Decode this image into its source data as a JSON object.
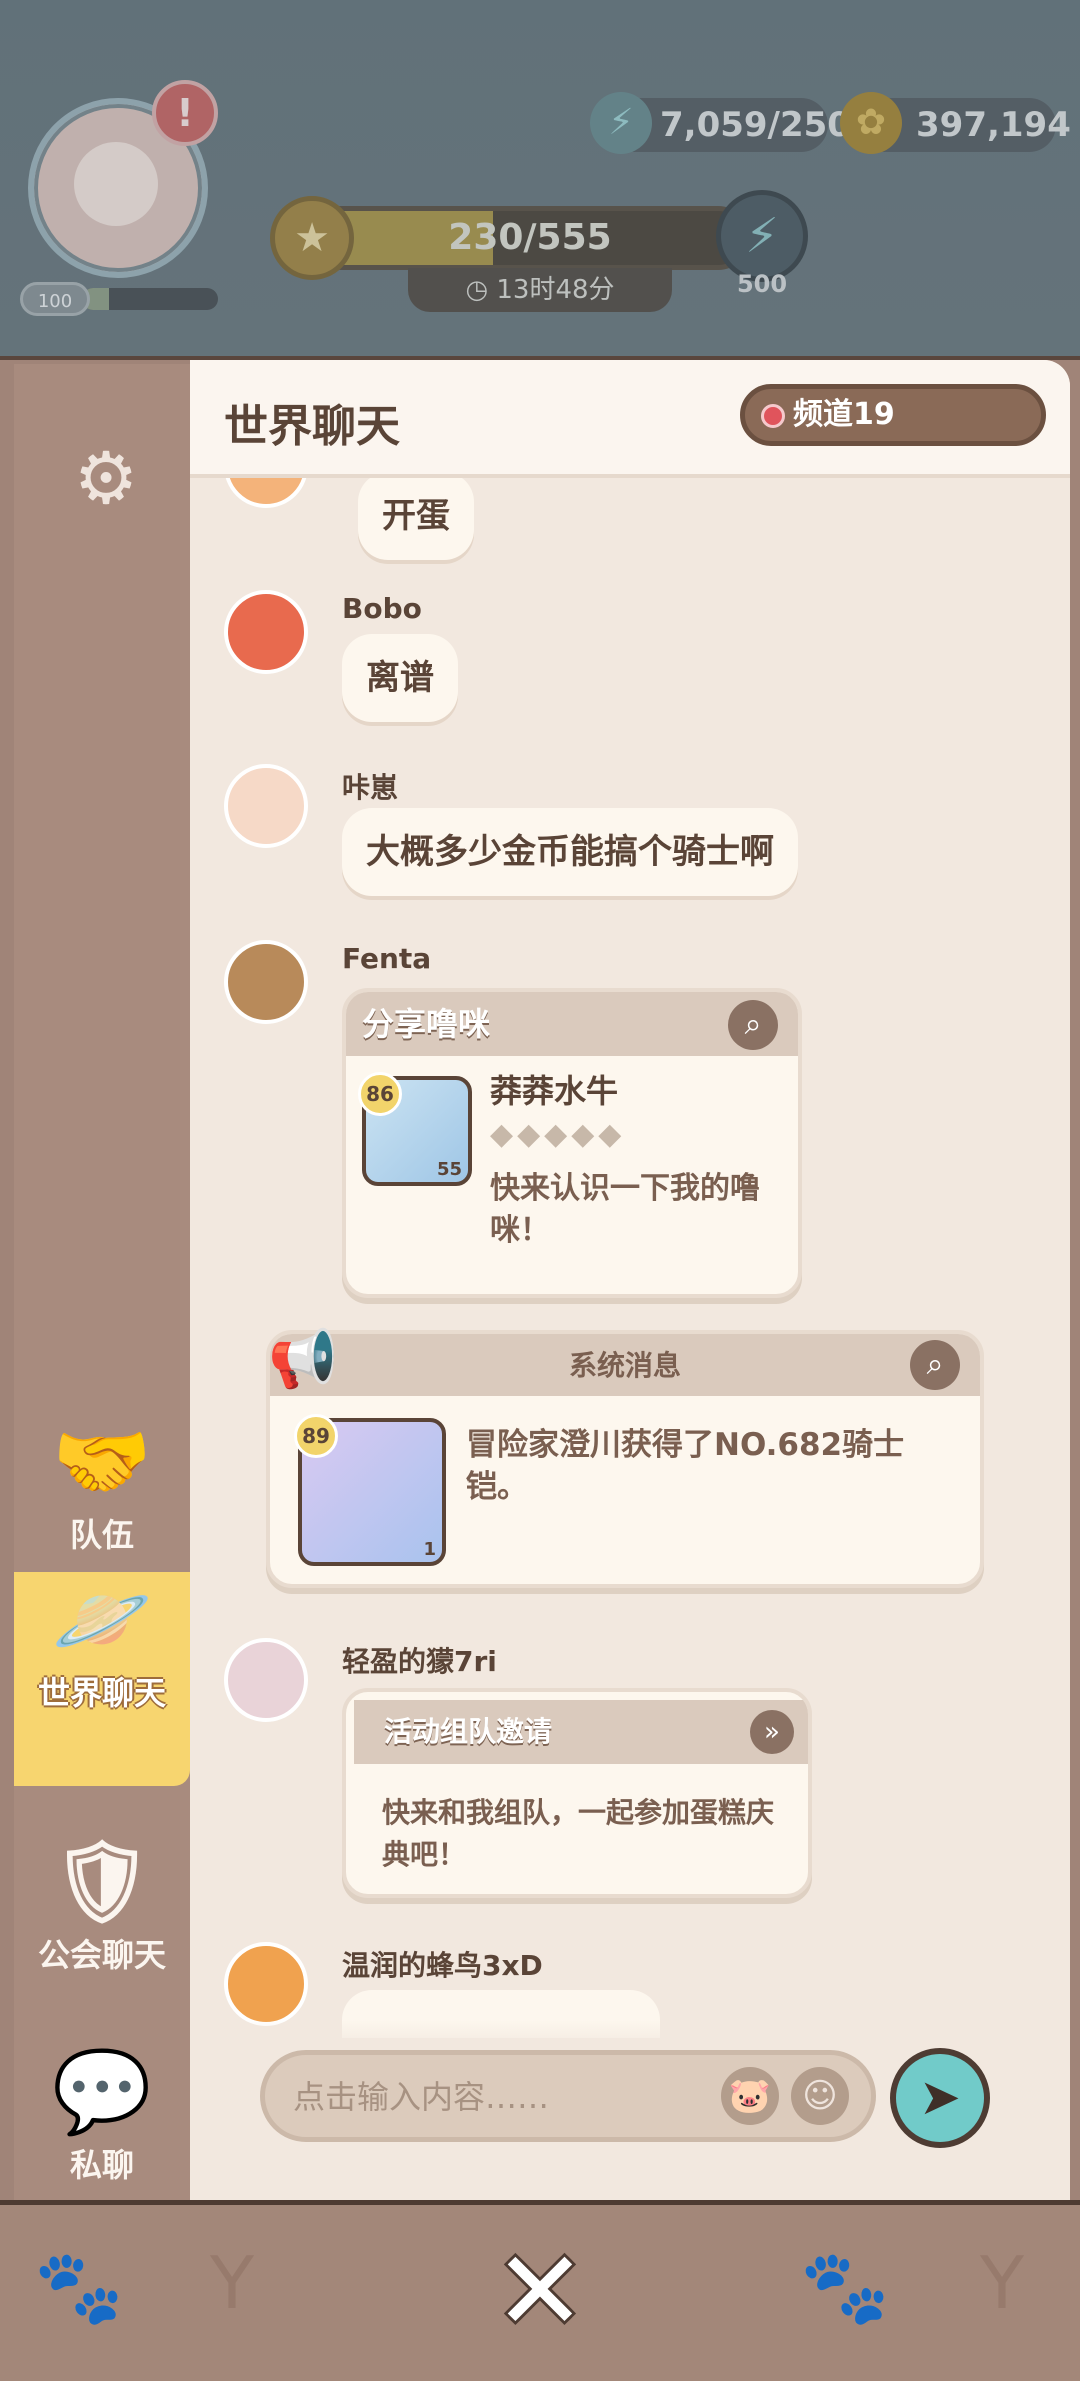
{
  "hud": {
    "alert_icon": "!",
    "player_level": "100",
    "level_progress": 0.2,
    "energy": "7,059/250",
    "coins": "397,194",
    "event_progress_text": "230/555",
    "event_progress": 0.414,
    "timer": "13时48分",
    "boost_count": "500"
  },
  "sidebar": {
    "team": "队伍",
    "world_chat": "世界聊天",
    "guild_chat": "公会聊天",
    "private_chat": "私聊"
  },
  "chat": {
    "title": "世界聊天",
    "channel": "频道19",
    "messages": [
      {
        "type": "text",
        "name": "",
        "text": "开蛋"
      },
      {
        "type": "text",
        "name": "Bobo",
        "text": "离谱"
      },
      {
        "type": "text",
        "name": "咔崽",
        "text": "大概多少金币能搞个骑士啊"
      },
      {
        "type": "pet_share",
        "name": "Fenta",
        "card_title": "分享噜咪",
        "pet_name": "莽莽水牛",
        "pet_level": "86",
        "pet_count": "55",
        "stars": 5,
        "body": "快来认识一下我的噜咪！"
      },
      {
        "type": "system",
        "card_title": "系统消息",
        "item_level": "89",
        "item_count": "1",
        "body": "冒险家澄川获得了NO.682骑士铠。"
      },
      {
        "type": "invite",
        "name": "轻盈的獴7ri",
        "card_title": "活动组队邀请",
        "body": "快来和我组队，一起参加蛋糕庆典吧！"
      },
      {
        "type": "text",
        "name": "温润的蜂鸟3xD",
        "text": ""
      }
    ],
    "input_placeholder": "点击输入内容……"
  },
  "colors": {
    "accent_yellow": "#f7d56f",
    "send_teal": "#71cbc9",
    "panel_brown": "#a08478",
    "chat_bg": "#f2e8df"
  }
}
